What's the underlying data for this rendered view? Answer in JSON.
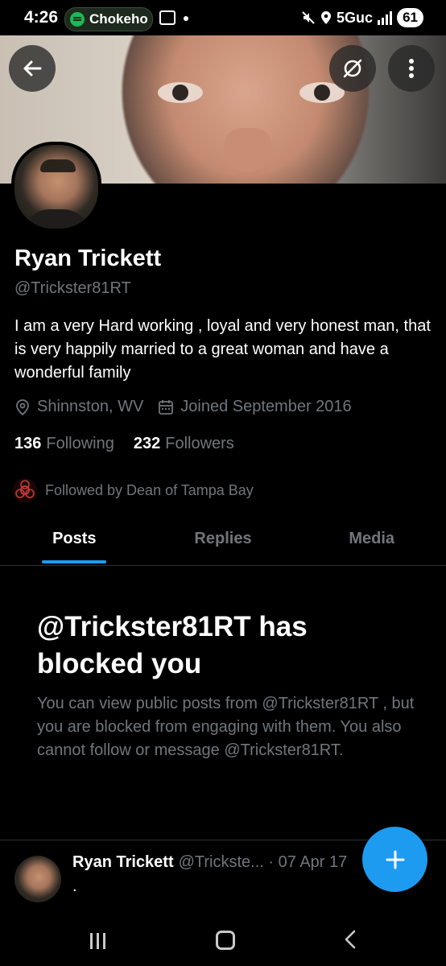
{
  "status_bar": {
    "time": "4:26",
    "media_label": "Chokeho",
    "network": "5Guc",
    "battery": "61"
  },
  "header": {
    "back_icon": "arrow-left-icon",
    "grok_icon": "grok-icon",
    "more_icon": "more-vertical-icon"
  },
  "profile": {
    "name": "Ryan Trickett",
    "handle": "@Trickster81RT",
    "bio": "I am a very Hard working , loyal and very honest man,  that is very happily married to a great woman and  have a wonderful family",
    "location": "Shinnston, WV",
    "joined": "Joined September 2016",
    "following_count": "136",
    "following_label": "Following",
    "followers_count": "232",
    "followers_label": "Followers",
    "followed_by": "Followed by Dean of Tampa Bay"
  },
  "tabs": [
    {
      "label": "Posts",
      "active": true
    },
    {
      "label": "Replies",
      "active": false
    },
    {
      "label": "Media",
      "active": false
    }
  ],
  "blocked": {
    "title": "@Trickster81RT has blocked you",
    "message": "You can view public posts from @Trickster81RT , but you are blocked from engaging with them. You also cannot follow or message @Trickster81RT."
  },
  "post": {
    "author": "Ryan Trickett",
    "handle": "@Trickste...",
    "date": "· 07 Apr 17",
    "text": "."
  },
  "colors": {
    "accent": "#1d9bf0",
    "background": "#000000",
    "secondary_text": "#71767b"
  }
}
